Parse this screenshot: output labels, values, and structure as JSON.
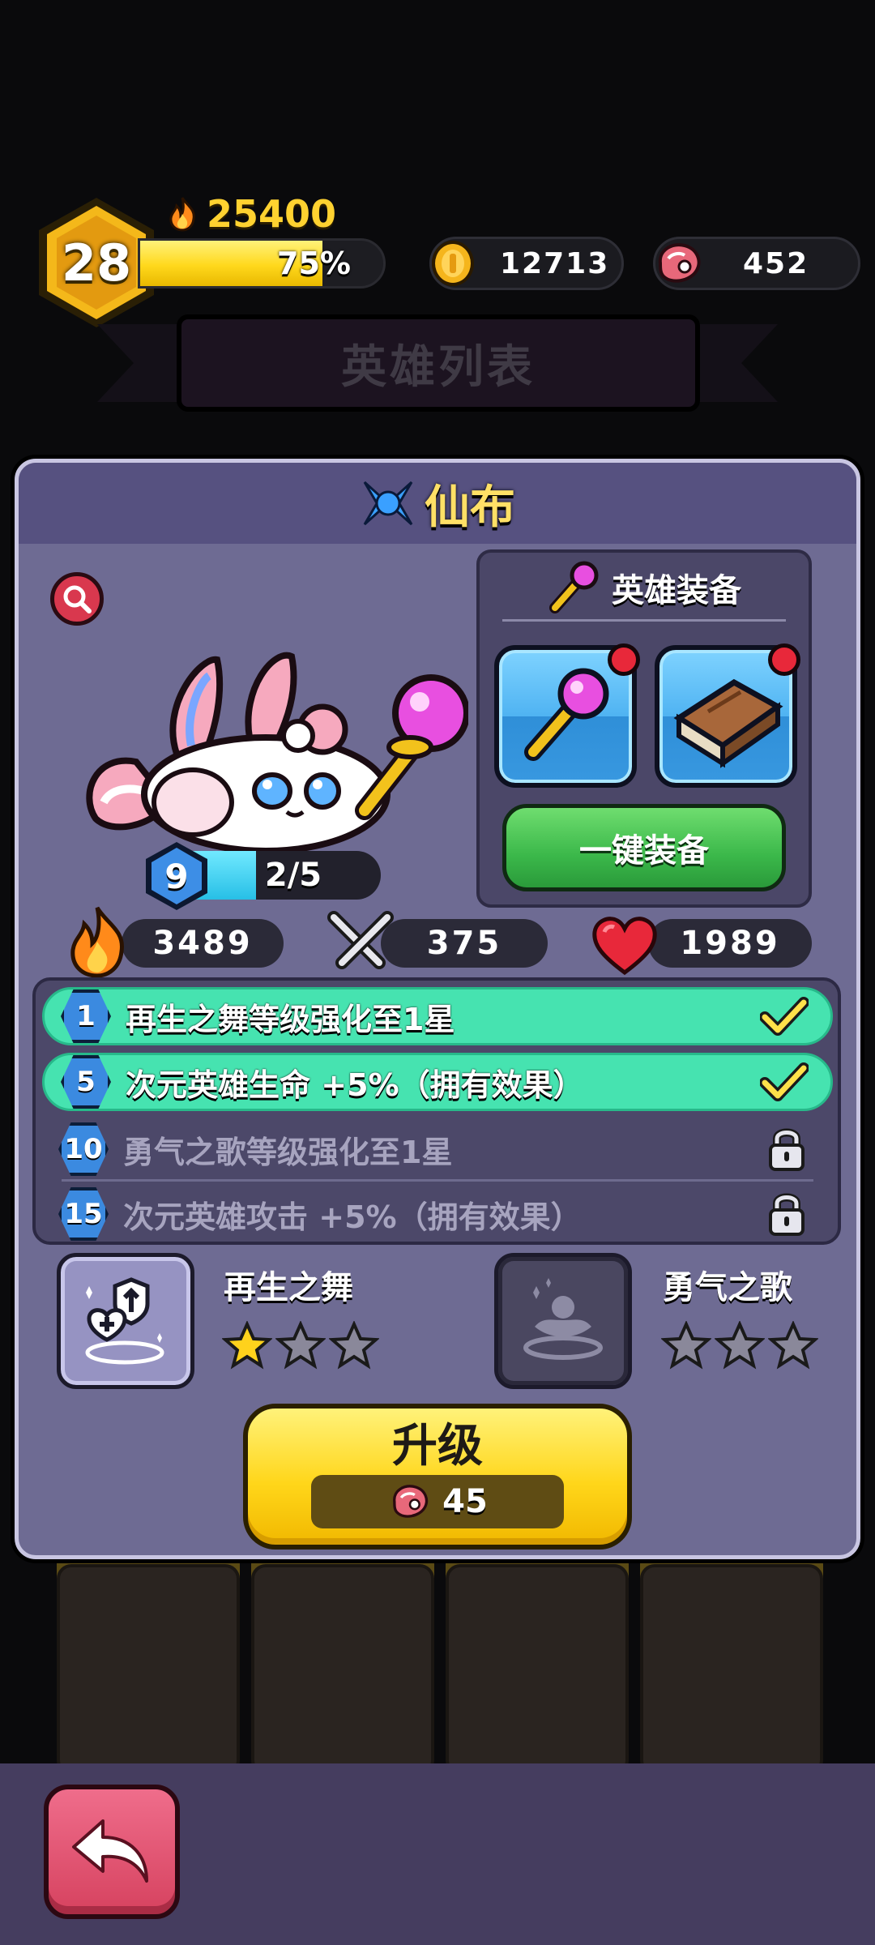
{
  "player": {
    "level": "28",
    "power": "25400",
    "xp_percent": 75,
    "xp_label": "75%",
    "gold": "12713",
    "meat": "452"
  },
  "screen_title": "英雄列表",
  "hero": {
    "name": "仙布",
    "level": "9",
    "shards_label": "2/5",
    "shards_fraction": 0.4,
    "stats": {
      "power": "3489",
      "attack": "375",
      "hp": "1989"
    }
  },
  "equipment": {
    "title": "英雄装备",
    "slots": [
      {
        "icon": "magic-wand-icon",
        "has_alert": true
      },
      {
        "icon": "spell-book-icon",
        "has_alert": true
      }
    ],
    "equip_all_label": "一键装备"
  },
  "milestones": [
    {
      "num": "1",
      "text": "再生之舞等级强化至1星",
      "status": "done"
    },
    {
      "num": "5",
      "text": "次元英雄生命  +5%（拥有效果）",
      "status": "done"
    },
    {
      "num": "10",
      "text": "勇气之歌等级强化至1星",
      "status": "locked"
    },
    {
      "num": "15",
      "text": "次元英雄攻击  +5%（拥有效果）",
      "status": "locked"
    }
  ],
  "skills": [
    {
      "name": "再生之舞",
      "stars": 1,
      "max_stars": 3,
      "unlocked": true
    },
    {
      "name": "勇气之歌",
      "stars": 0,
      "max_stars": 3,
      "unlocked": false
    }
  ],
  "upgrade": {
    "label": "升级",
    "cost": "45"
  },
  "colors": {
    "panel": "#6e6b93",
    "gold_text": "#ffd230",
    "done_row": "#46e3b0",
    "upgrade_yellow": "#ffd61a",
    "back_button": "#d6425f"
  }
}
